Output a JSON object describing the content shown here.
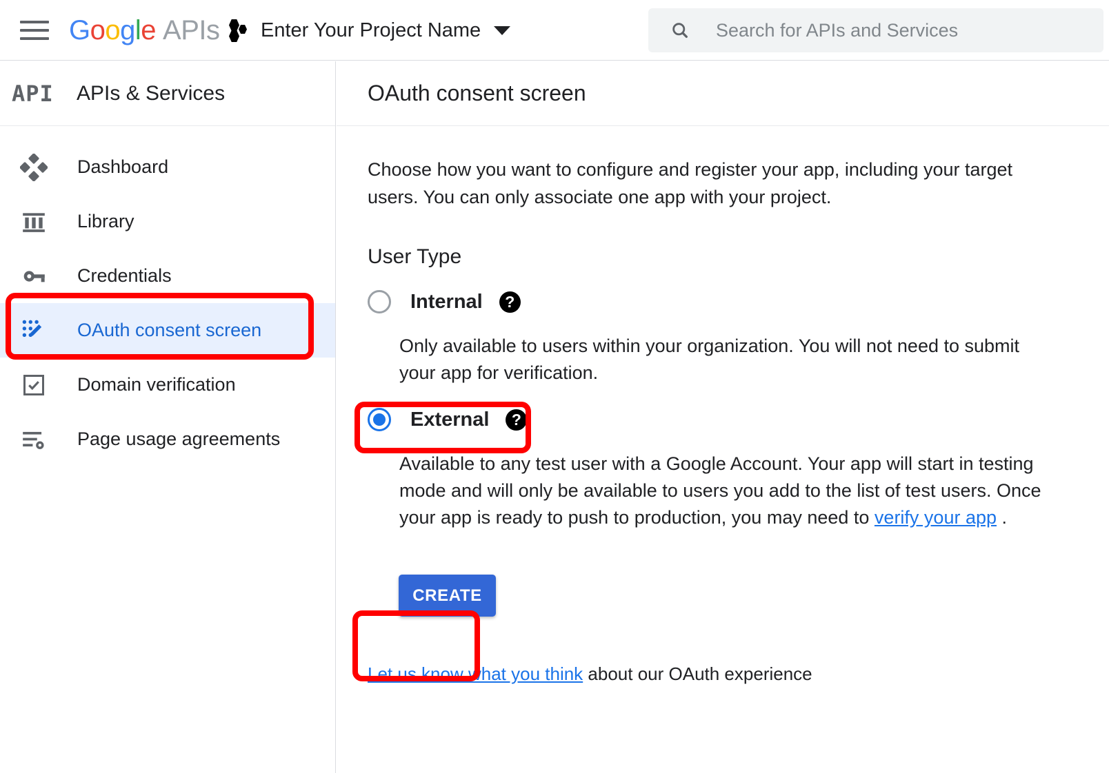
{
  "topbar": {
    "menu_icon": "hamburger-menu-icon",
    "brand": {
      "g": "G",
      "o1": "o",
      "o2": "o",
      "g2": "g",
      "l": "l",
      "e": "e",
      "suffix": "APIs"
    },
    "project": {
      "icon": "project-hexagons-icon",
      "name": "Enter Your Project Name",
      "caret_icon": "chevron-down-icon"
    },
    "search": {
      "icon": "search-icon",
      "placeholder": "Search for APIs and Services",
      "value": ""
    }
  },
  "sidebar": {
    "badge": "API",
    "title": "APIs & Services",
    "items": [
      {
        "label": "Dashboard",
        "icon": "dashboard-diamond-icon",
        "active": false
      },
      {
        "label": "Library",
        "icon": "library-icon",
        "active": false
      },
      {
        "label": "Credentials",
        "icon": "key-icon",
        "active": false
      },
      {
        "label": "OAuth consent screen",
        "icon": "oauth-consent-icon",
        "active": true
      },
      {
        "label": "Domain verification",
        "icon": "checkbox-icon",
        "active": false
      },
      {
        "label": "Page usage agreements",
        "icon": "list-settings-icon",
        "active": false
      }
    ]
  },
  "main": {
    "title": "OAuth consent screen",
    "intro": "Choose how you want to configure and register your app, including your target users. You can only associate one app with your project.",
    "user_type": {
      "heading": "User Type",
      "options": [
        {
          "label": "Internal",
          "selected": false,
          "help_icon": "help-question-icon",
          "description": "Only available to users within your organization. You will not need to submit your app for verification."
        },
        {
          "label": "External",
          "selected": true,
          "help_icon": "help-question-icon",
          "description_before_link": "Available to any test user with a Google Account. Your app will start in testing mode and will only be available to users you add to the list of test users. Once your app is ready to push to production, you may need to ",
          "link_text": "verify your app",
          "description_after_link": " ."
        }
      ]
    },
    "create_button": "CREATE",
    "feedback": {
      "link_text": "Let us know what you think",
      "rest": " about our OAuth experience"
    }
  },
  "annotations": {
    "highlight_color": "#ff0000",
    "boxes": [
      "oauth-consent-screen-nav-item",
      "external-radio-option",
      "create-button"
    ]
  },
  "colors": {
    "accent_blue": "#1a73e8",
    "button_blue": "#3367d6",
    "active_nav_bg": "#e8f0fe",
    "active_nav_text": "#1967d2",
    "annotation_red": "#ff0000"
  }
}
